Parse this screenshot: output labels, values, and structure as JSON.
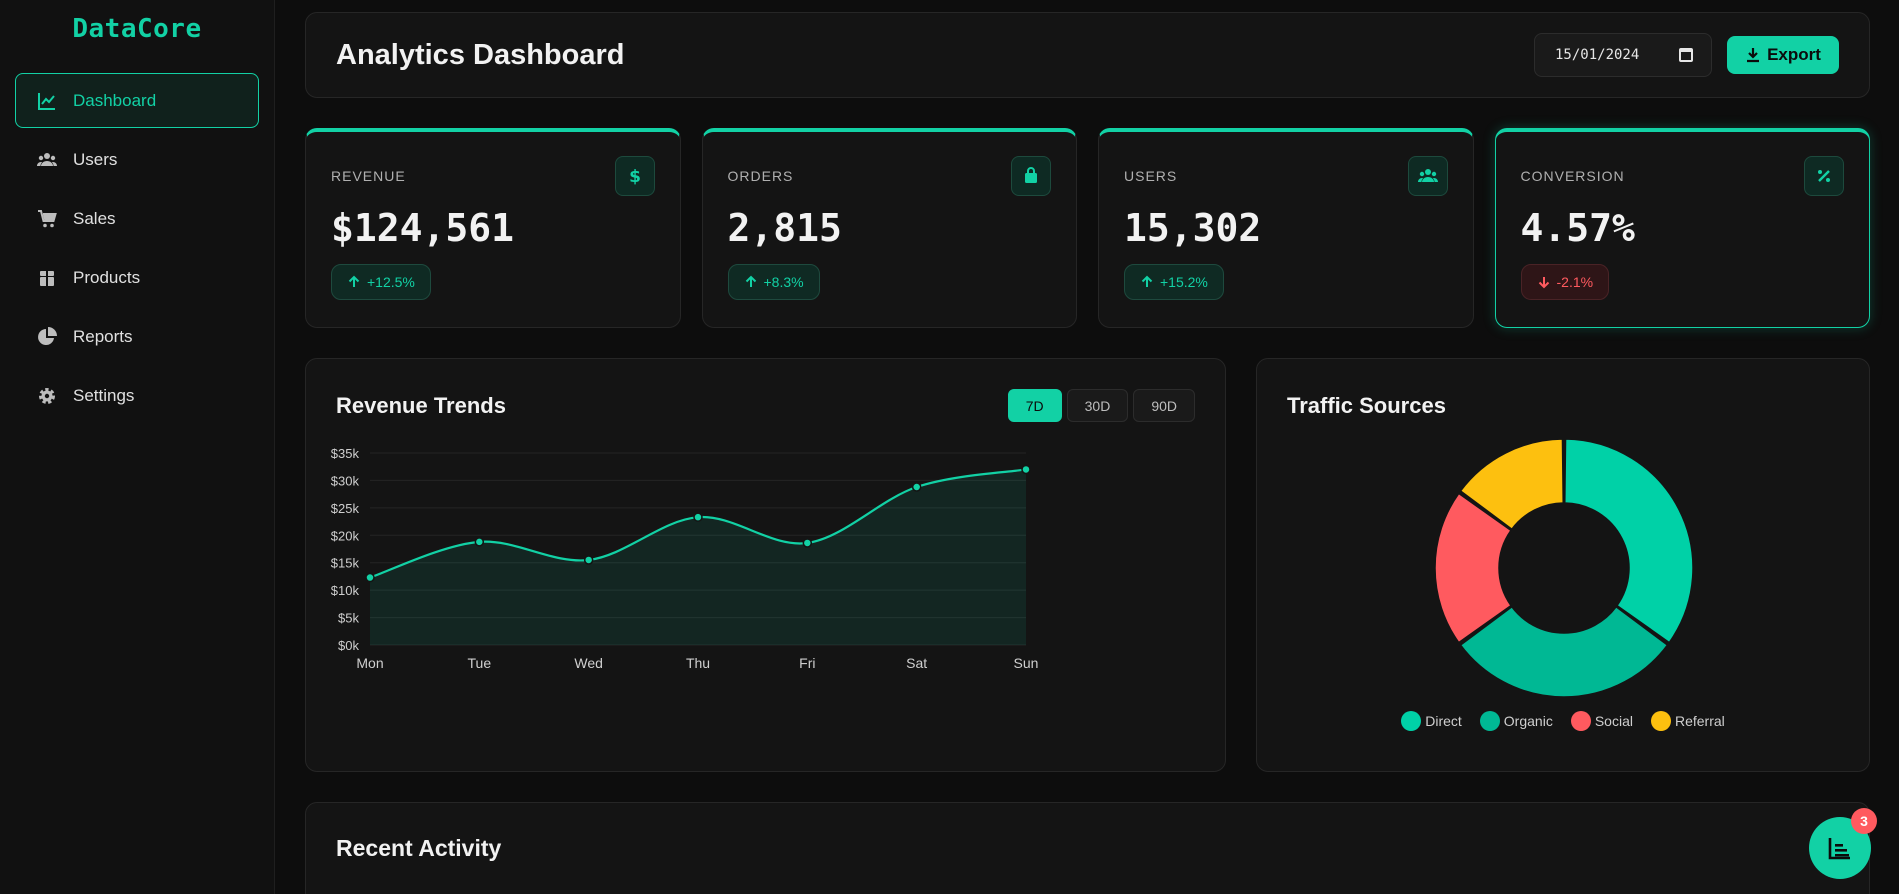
{
  "sidebar": {
    "brand": "DataCore",
    "items": [
      {
        "label": "Dashboard",
        "icon": "chart-line-icon",
        "active": true
      },
      {
        "label": "Users",
        "icon": "users-icon"
      },
      {
        "label": "Sales",
        "icon": "cart-icon"
      },
      {
        "label": "Products",
        "icon": "box-icon"
      },
      {
        "label": "Reports",
        "icon": "pie-chart-icon"
      },
      {
        "label": "Settings",
        "icon": "gear-icon"
      }
    ]
  },
  "header": {
    "title": "Analytics Dashboard",
    "date_value": "15/01/2024",
    "export_label": "Export"
  },
  "stats": [
    {
      "label": "REVENUE",
      "value": "$124,561",
      "change": "+12.5%",
      "trend": "up",
      "icon": "dollar-icon"
    },
    {
      "label": "ORDERS",
      "value": "2,815",
      "change": "+8.3%",
      "trend": "up",
      "icon": "shopping-bag-icon"
    },
    {
      "label": "USERS",
      "value": "15,302",
      "change": "+15.2%",
      "trend": "up",
      "icon": "users-icon"
    },
    {
      "label": "CONVERSION",
      "value": "4.57%",
      "change": "-2.1%",
      "trend": "down",
      "icon": "percent-icon"
    }
  ],
  "revenue_panel": {
    "title": "Revenue Trends",
    "ranges": [
      "7D",
      "30D",
      "90D"
    ],
    "active_range": "7D"
  },
  "traffic_panel": {
    "title": "Traffic Sources"
  },
  "activity_panel": {
    "title": "Recent Activity"
  },
  "fab": {
    "icon": "chart-bar-icon",
    "count": "3"
  },
  "colors": {
    "accent": "#12d1a5",
    "danger": "#ff5a5f",
    "warning": "#fdc00f"
  },
  "chart_data": [
    {
      "type": "area",
      "title": "Revenue Trends",
      "categories": [
        "Mon",
        "Tue",
        "Wed",
        "Thu",
        "Fri",
        "Sat",
        "Sun"
      ],
      "values": [
        12300,
        18800,
        15500,
        23300,
        18600,
        28800,
        32000
      ],
      "ylim": [
        0,
        35000
      ],
      "yticks": [
        "$0k",
        "$5k",
        "$10k",
        "$15k",
        "$20k",
        "$25k",
        "$30k",
        "$35k"
      ],
      "grid": true,
      "color": "#12d1a5"
    },
    {
      "type": "pie",
      "title": "Traffic Sources",
      "donut": true,
      "labels": [
        "Direct",
        "Organic",
        "Social",
        "Referral"
      ],
      "values": [
        35,
        30,
        20,
        15
      ],
      "colors": [
        "#00d1a7",
        "#00b894",
        "#ff5a5f",
        "#fdc00f"
      ],
      "legend": "bottom"
    }
  ]
}
